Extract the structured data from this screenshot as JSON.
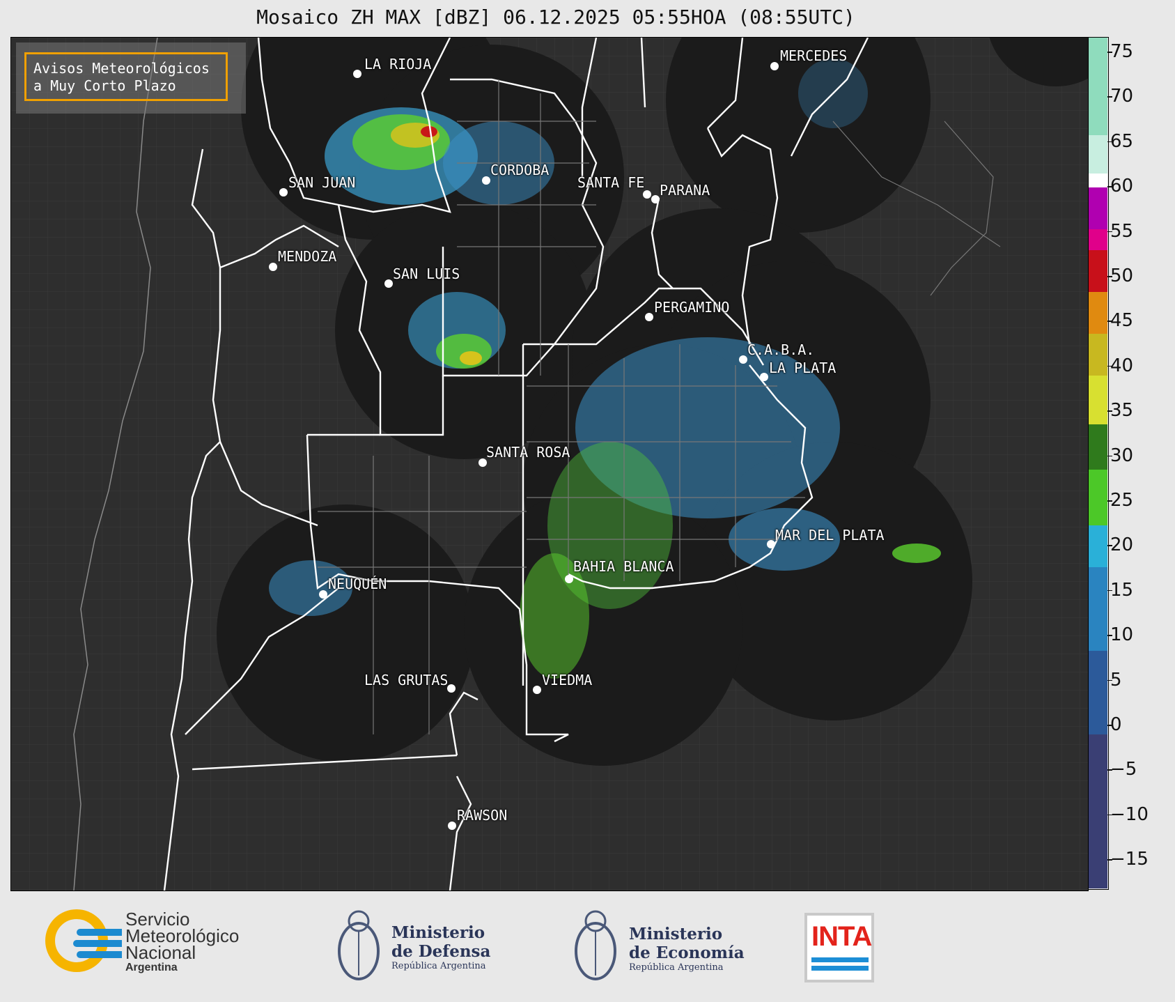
{
  "title": "Mosaico ZH MAX [dBZ] 06.12.2025 05:55HOA (08:55UTC)",
  "avisos": {
    "line1": "Avisos Meteorológicos",
    "line2": "a Muy Corto Plazo"
  },
  "cities": [
    {
      "name": "LA RIOJA"
    },
    {
      "name": "SAN JUAN"
    },
    {
      "name": "CORDOBA"
    },
    {
      "name": "SANTA FE"
    },
    {
      "name": "PARANA"
    },
    {
      "name": "MENDOZA"
    },
    {
      "name": "SAN LUIS"
    },
    {
      "name": "PERGAMINO"
    },
    {
      "name": "C.A.B.A."
    },
    {
      "name": "LA PLATA"
    },
    {
      "name": "MERCEDES"
    },
    {
      "name": "SANTA ROSA"
    },
    {
      "name": "MAR DEL PLATA"
    },
    {
      "name": "BAHIA BLANCA"
    },
    {
      "name": "NEUQUÉN"
    },
    {
      "name": "LAS GRUTAS"
    },
    {
      "name": "VIEDMA"
    },
    {
      "name": "RAWSON"
    }
  ],
  "colorbar": {
    "ticks": [
      "75",
      "70",
      "65",
      "60",
      "55",
      "50",
      "45",
      "40",
      "35",
      "30",
      "25",
      "20",
      "15",
      "10",
      "5",
      "0",
      "−5",
      "−10",
      "−15"
    ]
  },
  "logos": {
    "smn_line1": "Servicio",
    "smn_line2": "Meteorológico",
    "smn_line3": "Nacional",
    "smn_line4": "Argentina",
    "defensa_line1": "Ministerio",
    "defensa_line2": "de Defensa",
    "defensa_line3": "República Argentina",
    "economia_line1": "Ministerio",
    "economia_line2": "de Economía",
    "economia_line3": "República Argentina",
    "inta": "INTA"
  },
  "colors": {
    "radar_coverage": "#1b1b1b",
    "map_bg": "#2e2e2e",
    "border": "#ffffff",
    "accent": "#f0a000"
  }
}
